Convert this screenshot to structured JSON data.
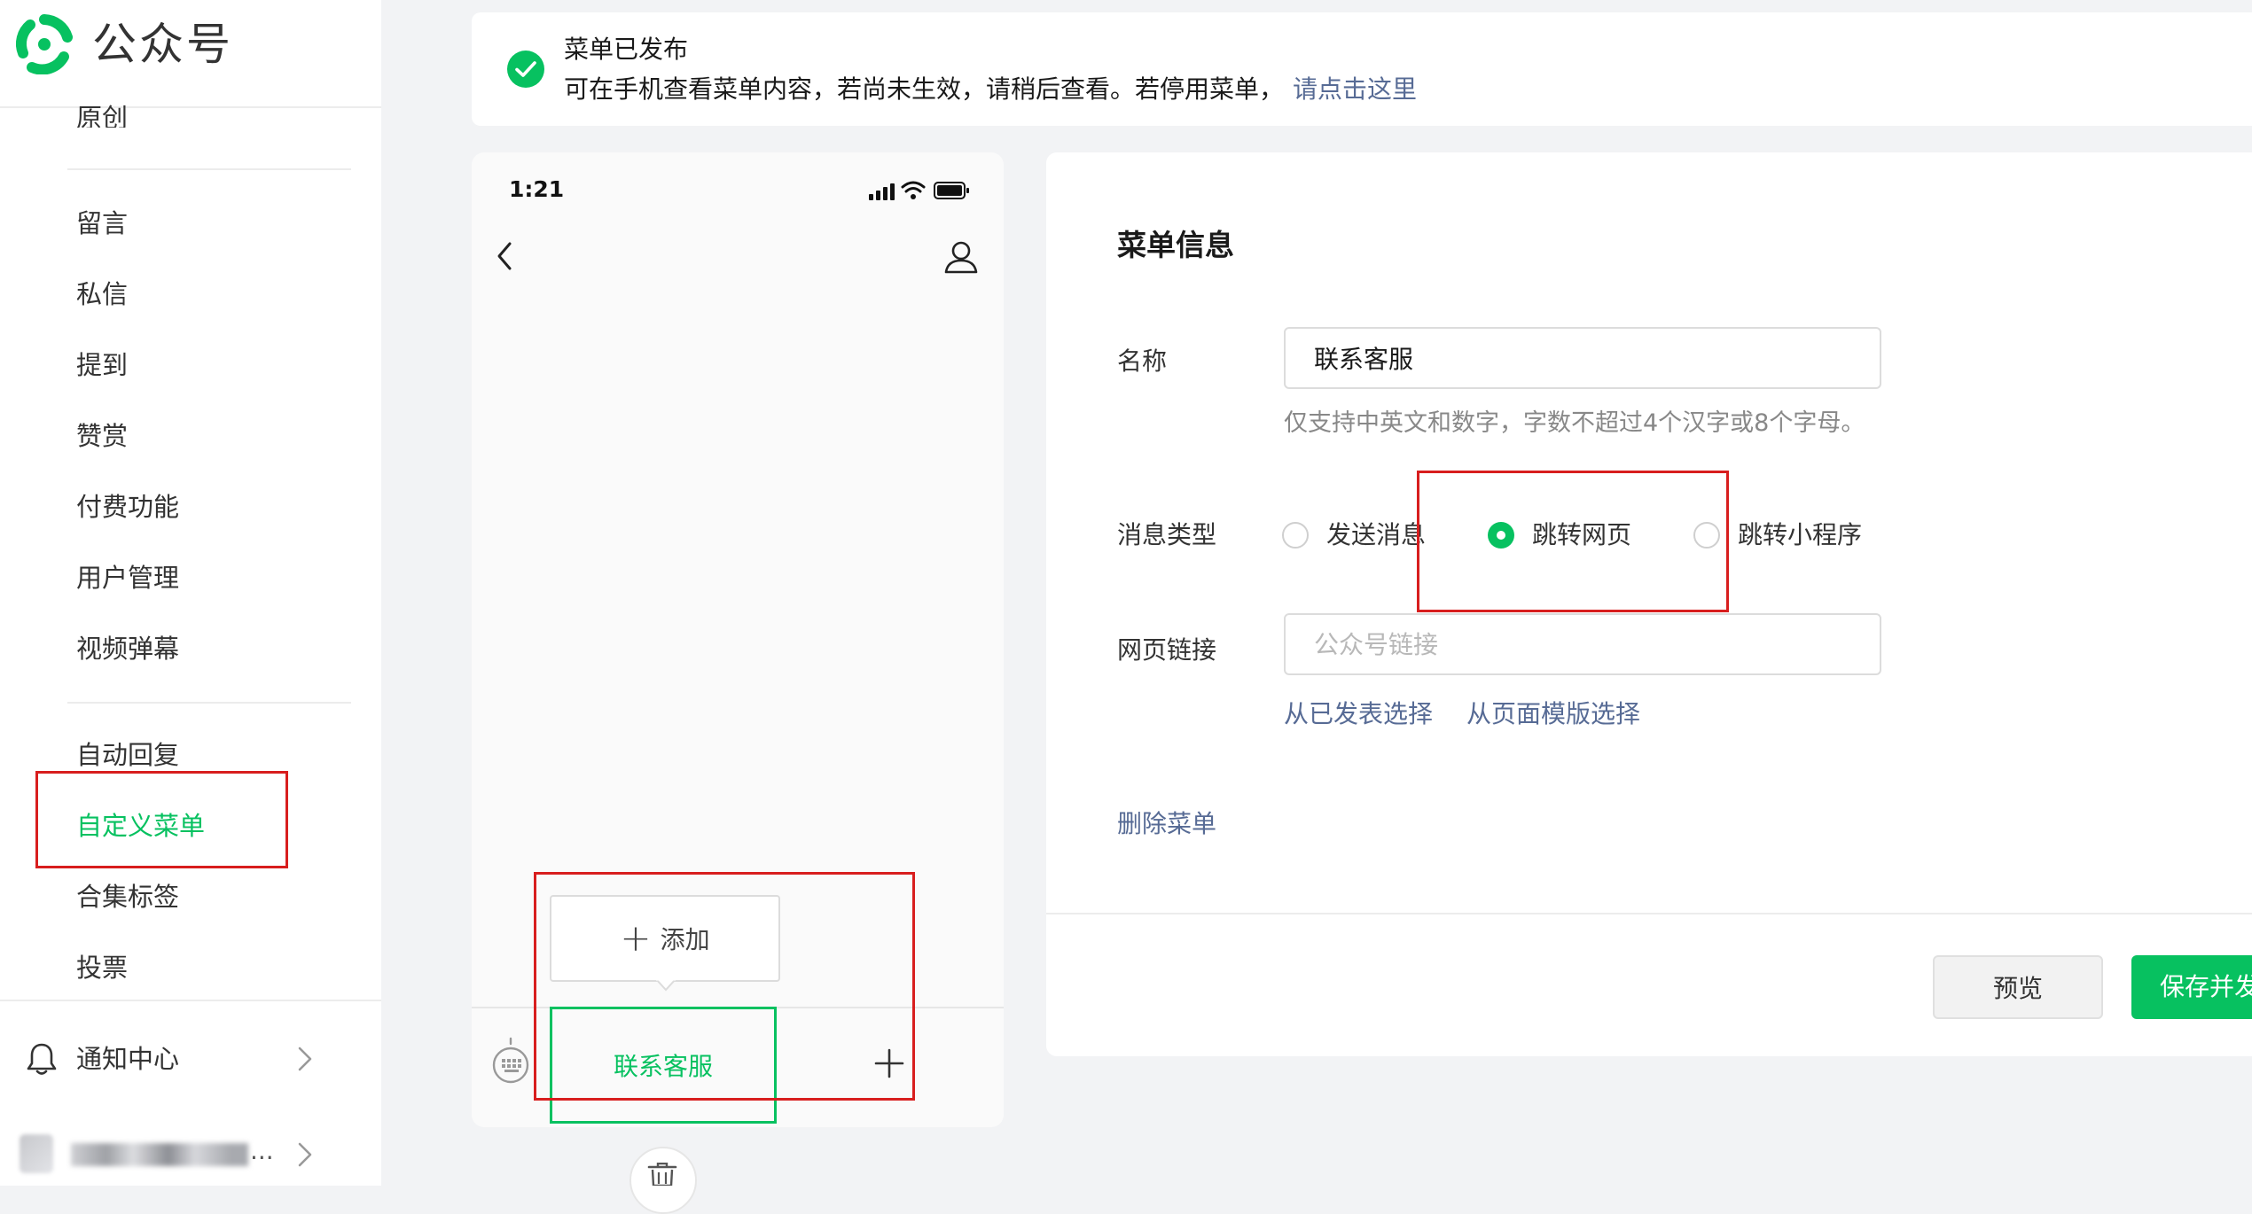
{
  "brand": {
    "name": "公众号",
    "accent": "#07c160"
  },
  "sidebar": {
    "items": [
      {
        "label": "原创"
      },
      {
        "label": "留言"
      },
      {
        "label": "私信"
      },
      {
        "label": "提到"
      },
      {
        "label": "赞赏"
      },
      {
        "label": "付费功能"
      },
      {
        "label": "用户管理"
      },
      {
        "label": "视频弹幕"
      },
      {
        "label": "自动回复"
      },
      {
        "label": "自定义菜单",
        "active": true
      },
      {
        "label": "合集标签"
      },
      {
        "label": "投票"
      }
    ],
    "notification": {
      "label": "通知中心",
      "icon": "bell-icon"
    },
    "account": {
      "ellipsis": "..."
    }
  },
  "notice": {
    "title": "菜单已发布",
    "body": "可在手机查看菜单内容，若尚未生效，请稍后查看。若停用菜单，",
    "link": "请点击这里",
    "icon": "check-circle-icon"
  },
  "phone": {
    "time": "1:21",
    "add_sub_label": "添加",
    "menu_tab_label": "联系客服"
  },
  "menu_info": {
    "title": "菜单信息",
    "name_label": "名称",
    "name_value": "联系客服",
    "name_hint": "仅支持中英文和数字，字数不超过4个汉字或8个字母。",
    "type_label": "消息类型",
    "type_options": [
      {
        "label": "发送消息",
        "checked": false
      },
      {
        "label": "跳转网页",
        "checked": true
      },
      {
        "label": "跳转小程序",
        "checked": false
      }
    ],
    "url_label": "网页链接",
    "url_placeholder": "公众号链接",
    "select_published": "从已发表选择",
    "select_template": "从页面模版选择",
    "delete_menu": "删除菜单"
  },
  "footer": {
    "preview_label": "预览",
    "save_label": "保存并发布"
  },
  "colors": {
    "highlight": "#d81e1e",
    "link": "#576b95",
    "accent": "#07c160"
  }
}
